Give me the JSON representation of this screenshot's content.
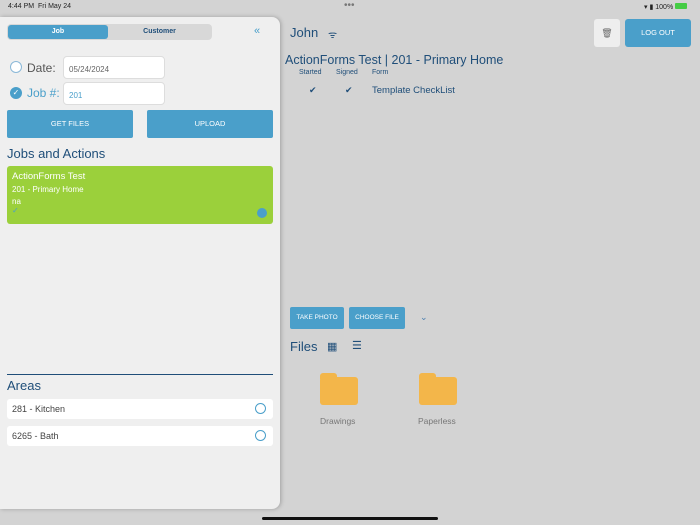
{
  "status": {
    "time": "4:44 PM",
    "date": "Fri May 24",
    "battery": "100%"
  },
  "sidebar": {
    "tabs": [
      "Job",
      "Customer"
    ],
    "date_label": "Date:",
    "date_value": "05/24/2024",
    "job_label": "Job #:",
    "job_value": "201",
    "get_files": "GET FILES",
    "upload": "UPLOAD",
    "jobs_heading": "Jobs and Actions",
    "job_card": {
      "title": "ActionForms Test",
      "subtitle": "201 - Primary Home",
      "note": "na"
    },
    "areas_heading": "Areas",
    "areas": [
      "281 - Kitchen",
      "6265 - Bath"
    ]
  },
  "main": {
    "user": "John",
    "logout": "LOG OUT",
    "job_title": "ActionForms Test | 201 - Primary Home",
    "columns": [
      "Started",
      "Signed",
      "Form"
    ],
    "form_row": {
      "form": "Template CheckList"
    },
    "take_photo": "TAKE PHOTO",
    "choose_file": "CHOOSE FILE",
    "files_heading": "Files",
    "folders": [
      "Drawings",
      "Paperless"
    ]
  },
  "colors": {
    "accent": "#4a9fca",
    "card": "#9bd03b",
    "folder": "#f3b64a"
  }
}
